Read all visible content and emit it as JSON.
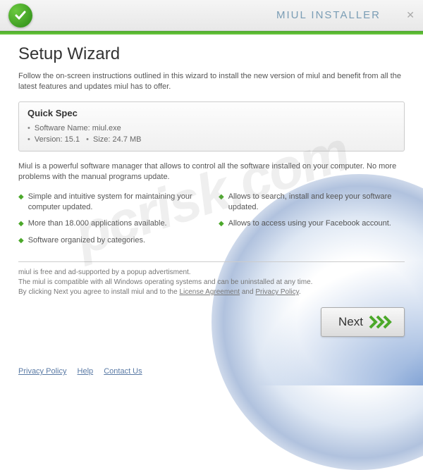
{
  "titlebar": {
    "title": "MIUL INSTALLER"
  },
  "heading": "Setup Wizard",
  "intro": "Follow the on-screen instructions outlined in this wizard to install the new version of miul and benefit from all the latest features and updates miul has to offer.",
  "spec": {
    "title": "Quick Spec",
    "software_label": "Software Name:",
    "software_value": "miul.exe",
    "version_label": "Version:",
    "version_value": "15.1",
    "size_label": "Size:",
    "size_value": "24.7 MB"
  },
  "desc": "Miul is a powerful software manager that allows to control all the software installed on your computer. No more problems with the manual programs update.",
  "features": {
    "left": [
      "Simple and intuitive system for maintaining your computer updated.",
      "More than 18.000 applications available.",
      "Software organized by categories."
    ],
    "right": [
      "Allows to search, install and keep your software updated.",
      "Allows to access using your Facebook account."
    ]
  },
  "fine": {
    "l1": "miul is free and ad-supported by a popup advertisment.",
    "l2": "The miul is compatible with all Windows operating systems and can be uninstalled at any time.",
    "l3_pre": "By clicking Next you agree to install miul and to the ",
    "license": "License Agreement",
    "l3_mid": " and ",
    "privacy": "Privacy Policy",
    "l3_end": "."
  },
  "buttons": {
    "next": "Next"
  },
  "footer": {
    "privacy": "Privacy Policy",
    "help": "Help",
    "contact": "Contact Us"
  },
  "watermark": "pcrisk.com"
}
